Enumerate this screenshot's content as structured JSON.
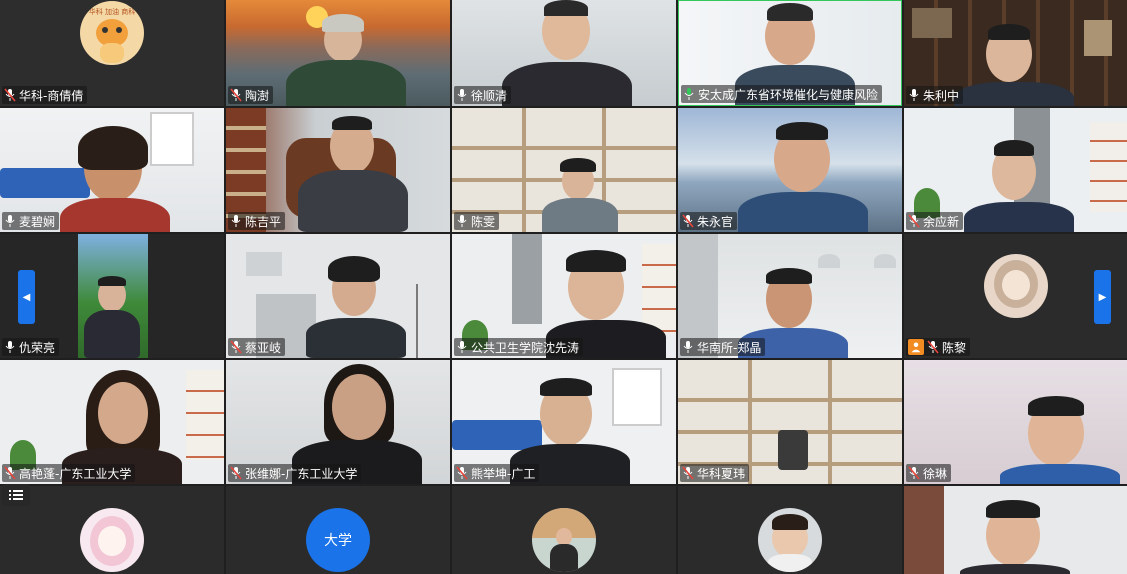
{
  "tiles": [
    {
      "name": "华科-商倩倩",
      "mic": "muted"
    },
    {
      "name": "陶澍",
      "mic": "muted"
    },
    {
      "name": "徐顺清",
      "mic": "on"
    },
    {
      "name": "安太成广东省环境催化与健康风险",
      "mic": "active"
    },
    {
      "name": "朱利中",
      "mic": "on"
    },
    {
      "name": "麦碧娴",
      "mic": "on"
    },
    {
      "name": "陈吉平",
      "mic": "on"
    },
    {
      "name": "陈雯",
      "mic": "on"
    },
    {
      "name": "朱永官",
      "mic": "muted"
    },
    {
      "name": "余应新",
      "mic": "muted"
    },
    {
      "name": "仇荣亮",
      "mic": "on"
    },
    {
      "name": "蔡亚岐",
      "mic": "muted"
    },
    {
      "name": "公共卫生学院沈先涛",
      "mic": "on"
    },
    {
      "name": "华南所-郑晶",
      "mic": "on"
    },
    {
      "name": "陈黎",
      "mic": "muted"
    },
    {
      "name": "高艳蓬-广东工业大学",
      "mic": "muted"
    },
    {
      "name": "张维娜-广东工业大学",
      "mic": "muted"
    },
    {
      "name": "熊举坤-广工",
      "mic": "muted"
    },
    {
      "name": "华科夏玮",
      "mic": "muted"
    },
    {
      "name": "徐琳",
      "mic": "muted"
    }
  ],
  "bottom_row": {
    "avatar_text": "大学"
  },
  "avatar_caption_top_left": "华科 加油 商科",
  "icons": {
    "prev": "chevron-left-icon",
    "next": "chevron-right-icon",
    "list": "participant-list-icon",
    "share": "screen-share-badge-icon"
  },
  "colors": {
    "accent_blue": "#1a73e8",
    "active_mic": "#34c759",
    "muted_mic": "#e8453c",
    "grid_bg": "#1f1f1f"
  }
}
